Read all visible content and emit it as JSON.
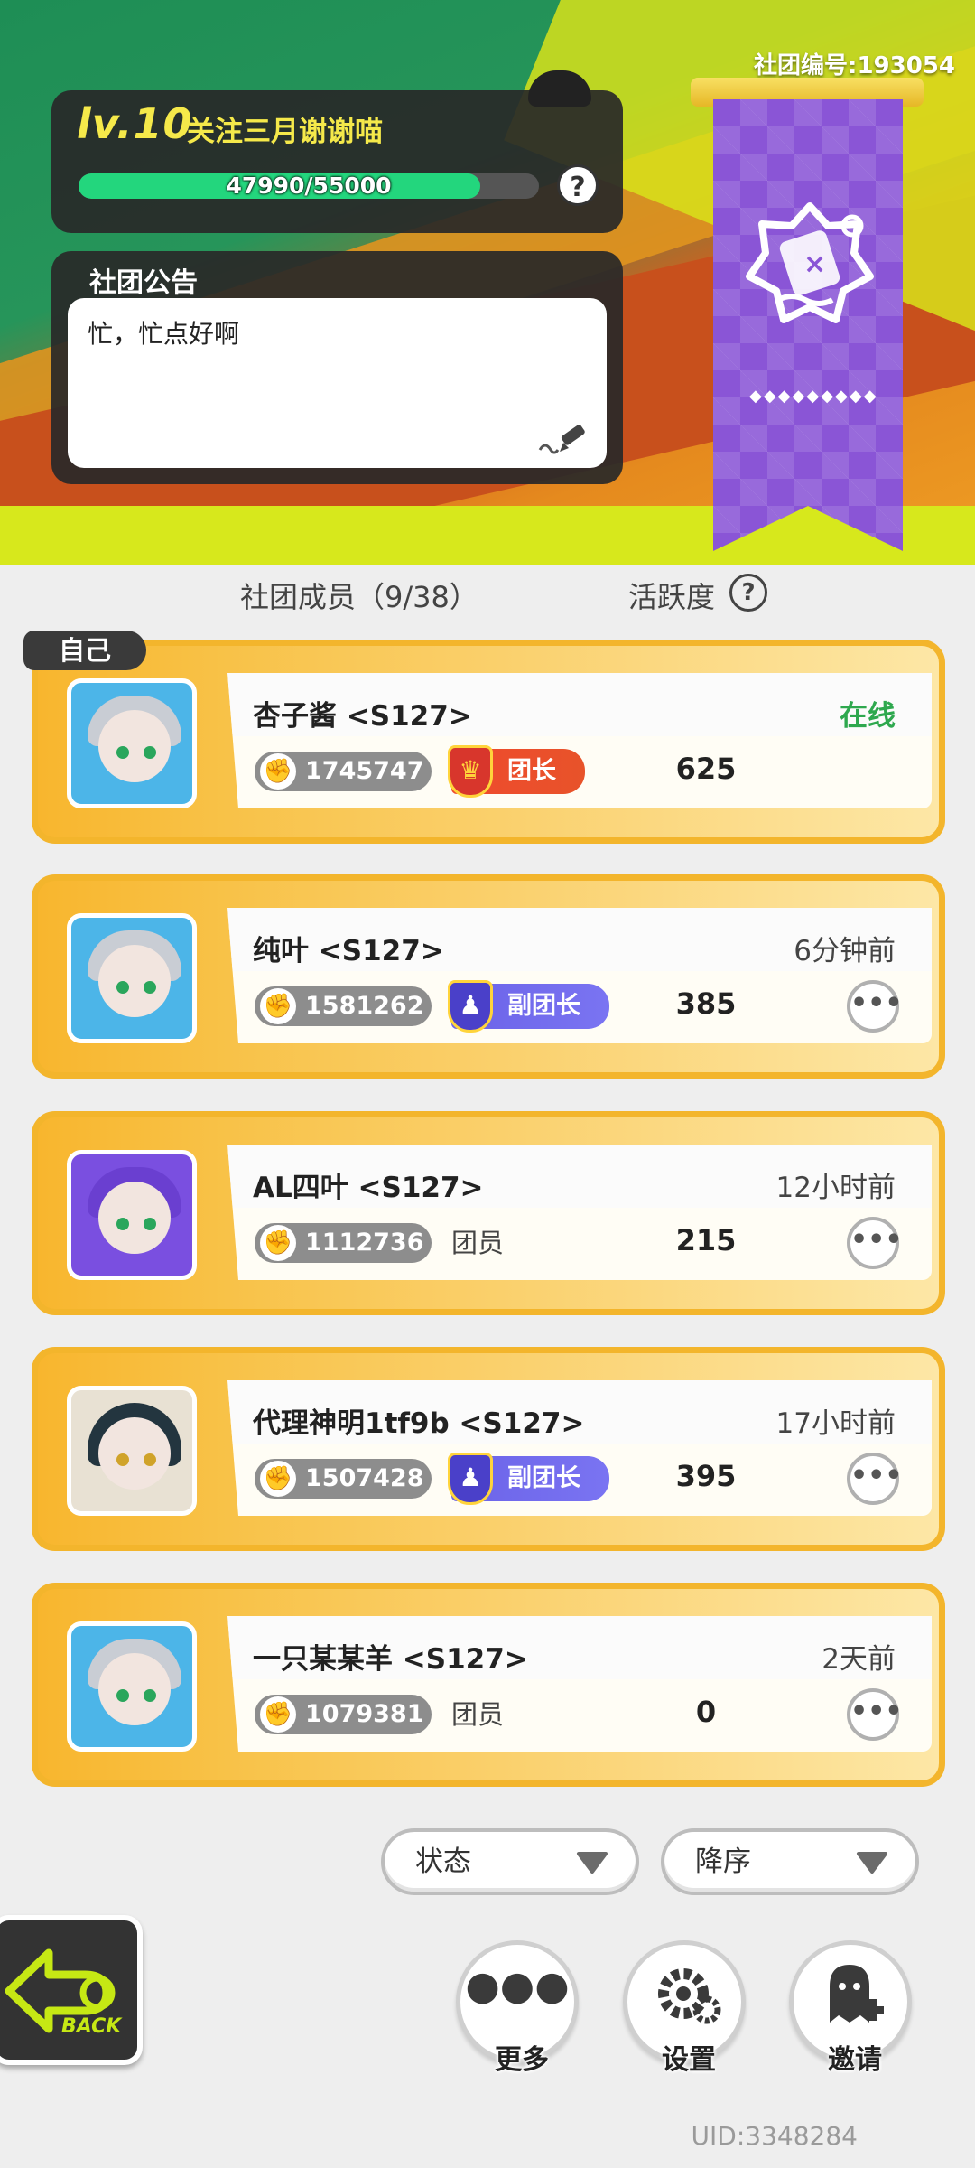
{
  "club_id": "社团编号:193054",
  "level": {
    "label": "lv.10",
    "club_name": "关注三月谢谢喵",
    "xp_text": "47990/55000",
    "xp_fraction": 0.8725
  },
  "notice": {
    "title": "社团公告",
    "text": "忙，忙点好啊"
  },
  "members_header": {
    "title": "社团成员（9/38）",
    "activity_title": "活跃度"
  },
  "self_tag": "自己",
  "members": [
    {
      "name": "杏子酱 <S127>",
      "status": "在线",
      "online": true,
      "power": "1745747",
      "role": "团长",
      "role_type": "leader",
      "activity": "625",
      "avatar": "silver-hair-girl-avatar"
    },
    {
      "name": "纯叶 <S127>",
      "status": "6分钟前",
      "online": false,
      "power": "1581262",
      "role": "副团长",
      "role_type": "vice",
      "activity": "385",
      "avatar": "silver-hair-girl-avatar"
    },
    {
      "name": "AL四叶 <S127>",
      "status": "12小时前",
      "online": false,
      "power": "1112736",
      "role": "团员",
      "role_type": "member",
      "activity": "215",
      "avatar": "purple-hair-girl-avatar"
    },
    {
      "name": "代理神明1tf9b <S127>",
      "status": "17小时前",
      "online": false,
      "power": "1507428",
      "role": "副团长",
      "role_type": "vice",
      "activity": "395",
      "avatar": "dark-hair-character-avatar"
    },
    {
      "name": "一只某某羊 <S127>",
      "status": "2天前",
      "online": false,
      "power": "1079381",
      "role": "团员",
      "role_type": "member",
      "activity": "0",
      "avatar": "silver-hair-girl-avatar"
    }
  ],
  "sort": {
    "status_label": "状态",
    "order_label": "降序"
  },
  "actions": {
    "more": "更多",
    "settings": "设置",
    "invite": "邀请"
  },
  "back_label": "BACK",
  "uid": "UID:3348284",
  "colors": {
    "xp_fill": "#23d67d",
    "card_border": "#f3b52c",
    "online": "#2ea84e",
    "leader": "#ef4a2e",
    "vice": "#6b63e8",
    "banner": "#8a55d6",
    "slime": "#d7e81c"
  }
}
